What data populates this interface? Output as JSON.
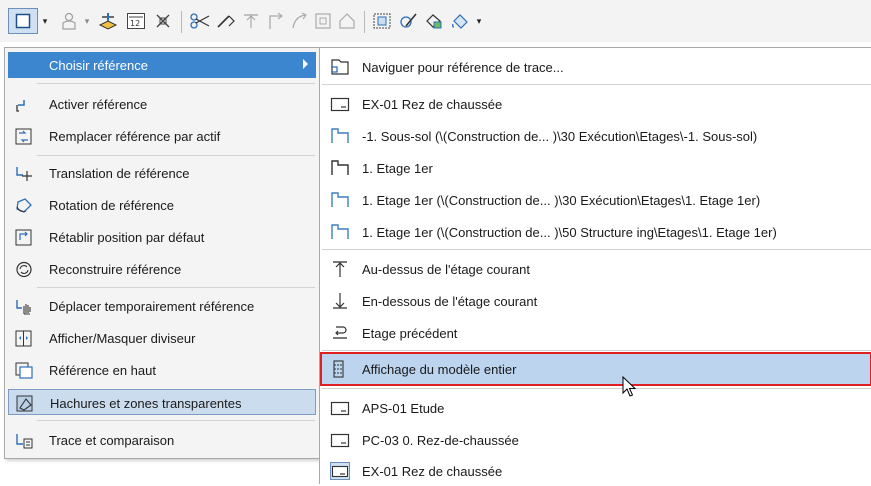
{
  "menu": {
    "choose_reference": "Choisir référence",
    "activate": "Activer référence",
    "replace": "Remplacer référence par actif",
    "translate": "Translation de référence",
    "rotate": "Rotation de référence",
    "reset_position": "Rétablir position par défaut",
    "rebuild": "Reconstruire référence",
    "move_temp": "Déplacer temporairement référence",
    "toggle_divider": "Afficher/Masquer diviseur",
    "reference_top": "Référence en haut",
    "hatch_transparent": "Hachures et zones transparentes",
    "trace_compare": "Trace et comparaison"
  },
  "submenu": {
    "browse": "Naviguer pour référence de trace...",
    "items": [
      "EX-01 Rez de chaussée",
      "-1. Sous-sol (\\(Construction de... )\\30 Exécution\\Etages\\-1. Sous-sol)",
      "1. Etage 1er",
      "1. Etage 1er (\\(Construction de... )\\30 Exécution\\Etages\\1. Etage 1er)",
      "1. Etage 1er (\\(Construction de... )\\50 Structure ing\\Etages\\1. Etage 1er)"
    ],
    "above": "Au-dessus de l'étage courant",
    "below": "En-dessous de l'étage courant",
    "previous": "Etage précédent",
    "whole_model": "Affichage du modèle entier",
    "recent": [
      "APS-01 Etude",
      "PC-03 0. Rez-de-chaussée",
      "EX-01 Rez de chaussée"
    ]
  },
  "colors": {
    "highlight": "#3c86cf",
    "selected": "#bcd4ee",
    "selected_border": "#e02020",
    "icon_blue": "#3b7fc4"
  }
}
